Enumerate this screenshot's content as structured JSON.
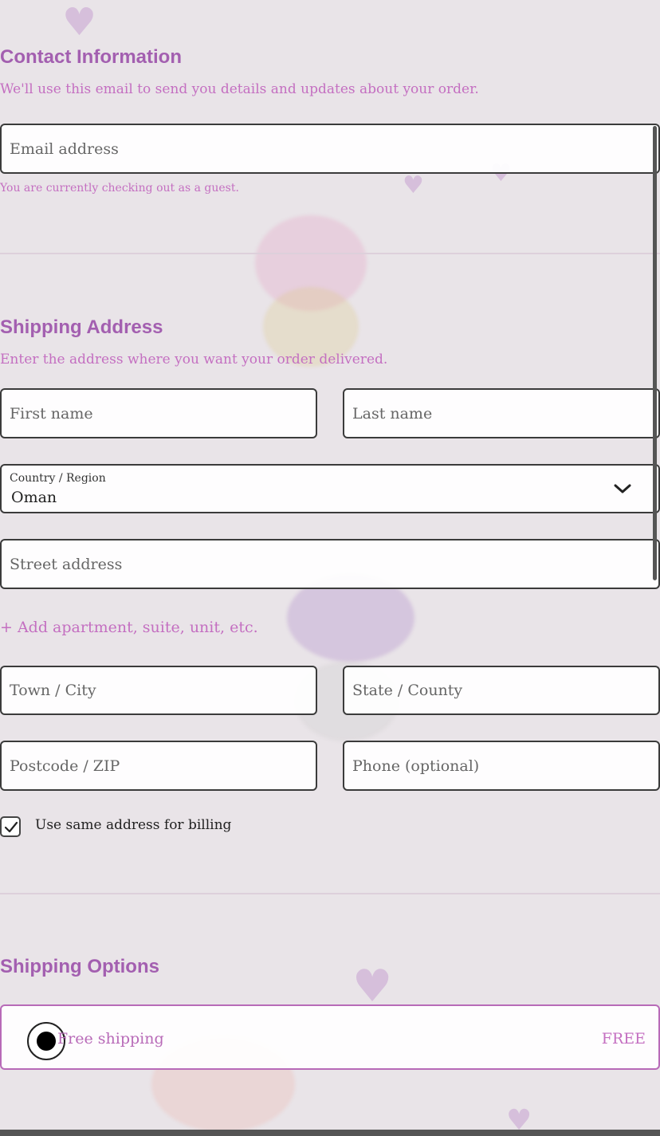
{
  "contact": {
    "title": "Contact Information",
    "description": "We'll use this email to send you details and updates about your order.",
    "email_placeholder": "Email address",
    "guest_note": "You are currently checking out as a guest."
  },
  "shipping_address": {
    "title": "Shipping Address",
    "description": "Enter the address where you want your order delivered.",
    "first_name_placeholder": "First name",
    "last_name_placeholder": "Last name",
    "country_label": "Country / Region",
    "country_value": "Oman",
    "street_placeholder": "Street address",
    "add_apartment_link": "+ Add apartment, suite, unit, etc.",
    "city_placeholder": "Town / City",
    "state_placeholder": "State / County",
    "postcode_placeholder": "Postcode / ZIP",
    "phone_placeholder": "Phone (optional)",
    "same_billing_label": "Use same address for billing",
    "same_billing_checked": true
  },
  "shipping_options": {
    "title": "Shipping Options",
    "option_label": "Free shipping",
    "option_price": "FREE",
    "option_selected": true
  },
  "colors": {
    "heading": "#a35fb0",
    "description": "#c46fc1",
    "selected_border": "#b86ab8"
  },
  "icons": {
    "country_dropdown": "chevron-down-icon",
    "billing_checkbox": "checkmark-icon"
  }
}
